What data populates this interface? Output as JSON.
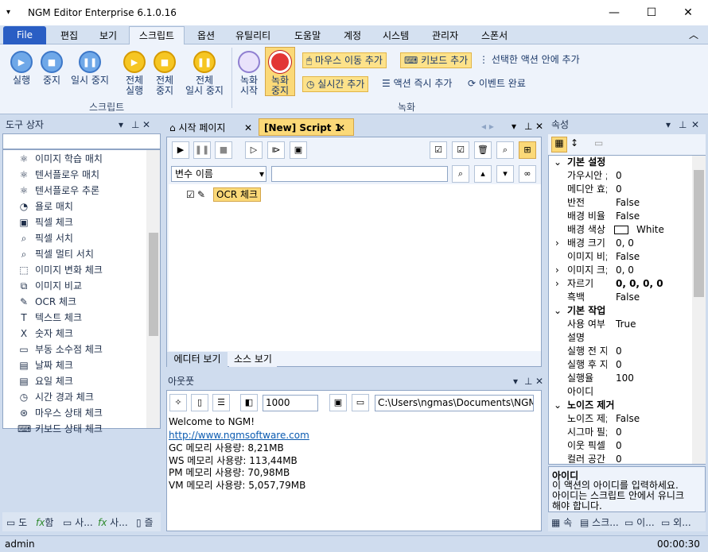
{
  "app": {
    "title": "NGM Editor   Enterprise 6.1.0.16",
    "minimize": "—",
    "maximize": "☐",
    "close": "✕",
    "collapse": "︿"
  },
  "menu": {
    "file": "File",
    "items": [
      "편집",
      "보기",
      "스크립트",
      "옵션",
      "유틸리티",
      "도움말",
      "계정",
      "시스템",
      "관리자",
      "스폰서"
    ],
    "active": "스크립트"
  },
  "ribbon": {
    "play": "실행",
    "stop": "중지",
    "pause": "일시 중지",
    "all_play": [
      "전체",
      "실행"
    ],
    "all_stop": [
      "전체",
      "중지"
    ],
    "all_pause": [
      "전체",
      "일시 중지"
    ],
    "record_start": [
      "녹화",
      "시작"
    ],
    "record_stop": [
      "녹화",
      "중지"
    ],
    "mouse_move": "마우스 이동 추가",
    "keyboard": "키보드 추가",
    "add_in_selected": "선택한 액션 안에 추가",
    "realtime": "실시간 추가",
    "instant": "액션 즉시 추가",
    "event_done": "이벤트 완료",
    "group_script": "스크립트",
    "group_record": "녹화"
  },
  "toolbox": {
    "title": "도구 상자",
    "items": [
      "이미지 학습 매치",
      "텐서플로우 매치",
      "텐서플로우 추론",
      "욜로 매치",
      "픽셀 체크",
      "픽셀 서치",
      "픽셀 멀티 서치",
      "이미지 변화 체크",
      "이미지 비교",
      "OCR 체크",
      "텍스트 체크",
      "숫자 체크",
      "부동 소수점 체크",
      "날짜 체크",
      "요일 체크",
      "시간 경과 체크",
      "마우스 상태 체크",
      "키보드 상태 체크"
    ],
    "bottom_tabs": [
      "도",
      "함",
      "사...",
      "사...",
      "즐"
    ]
  },
  "editor": {
    "tabs": [
      "시작 페이지",
      "[New] Script 1"
    ],
    "var_select": "변수 이름",
    "node_label": "OCR 체크",
    "view_tabs": [
      "에디터 보기",
      "소스 보기"
    ]
  },
  "output": {
    "title": "아웃풋",
    "count": "1000",
    "path": "C:\\Users\\ngmas\\Documents\\NGM6\\",
    "lines": [
      "Welcome to NGM!",
      "http://www.ngmsoftware.com",
      "GC 메모리 사용량: 8,21MB",
      "WS 메모리 사용량: 113,44MB",
      "PM 메모리 사용량: 70,98MB",
      "VM 메모리 사용량: 5,057,79MB"
    ]
  },
  "properties": {
    "title": "속성",
    "rows": [
      {
        "cat": true,
        "name": "기본 설정",
        "val": ""
      },
      {
        "name": "가우시안 ;",
        "val": "0"
      },
      {
        "name": "메디안 효;",
        "val": "0"
      },
      {
        "name": "반전",
        "val": "False"
      },
      {
        "name": "배경 비율",
        "val": "False"
      },
      {
        "name": "배경 색상",
        "val": "White"
      },
      {
        "name": "배경 크기",
        "val": "0, 0"
      },
      {
        "name": "이미지 비;",
        "val": "False"
      },
      {
        "name": "이미지 크;",
        "val": "0, 0"
      },
      {
        "name": "자르기",
        "val": "0, 0, 0, 0"
      },
      {
        "name": "흑백",
        "val": "False"
      },
      {
        "cat": true,
        "name": "기본 작업",
        "val": ""
      },
      {
        "name": "사용 여부",
        "val": "True"
      },
      {
        "name": "설명",
        "val": ""
      },
      {
        "name": "실행 전 지",
        "val": "0"
      },
      {
        "name": "실행 후 지",
        "val": "0"
      },
      {
        "name": "실행율",
        "val": "100"
      },
      {
        "name": "아이디",
        "val": ""
      },
      {
        "cat": true,
        "name": "노이즈 제거",
        "val": ""
      },
      {
        "name": "노이즈 제;",
        "val": "False"
      },
      {
        "name": "시그마 필;",
        "val": "0"
      },
      {
        "name": "이웃 픽셀",
        "val": "0"
      },
      {
        "name": "컬러 공간",
        "val": "0"
      }
    ],
    "desc_title": "아이디",
    "desc_text": [
      "이 액션의 아이디를 입력하세요.",
      "아이디는 스크립트 안에서 유니크",
      "해야 합니다."
    ],
    "bottom_tabs": [
      "속",
      "스크...",
      "이...",
      "외..."
    ]
  },
  "status": {
    "user": "admin",
    "time": "00:00:30"
  }
}
